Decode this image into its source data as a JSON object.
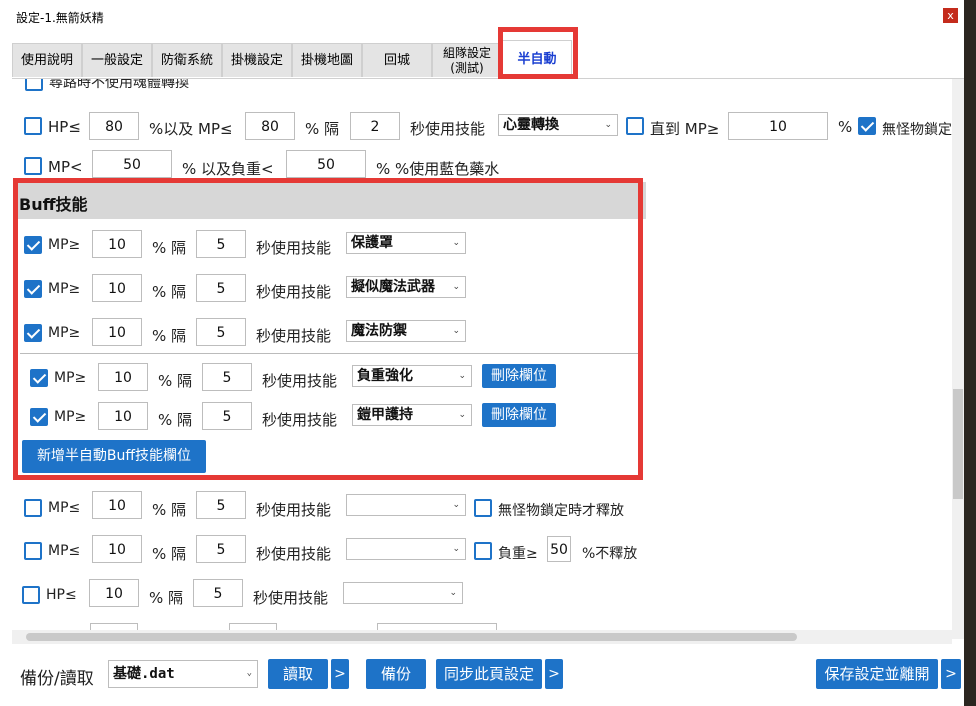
{
  "window": {
    "title": "設定-1.無箭妖精",
    "close_label": "x"
  },
  "tabs": [
    {
      "label": "使用說明"
    },
    {
      "label": "一般設定"
    },
    {
      "label": "防衛系統"
    },
    {
      "label": "掛機設定"
    },
    {
      "label": "掛機地圖"
    },
    {
      "label": "回城"
    },
    {
      "label": "組隊設定\n(測試)"
    },
    {
      "label": "半自動",
      "active": true
    }
  ],
  "top_rows": {
    "partial_label": "尋路時不使用魂體轉換",
    "hp_row": {
      "hp_label": "HP≤",
      "hp_value": "80",
      "mp_label": "%以及 MP≤",
      "mp_value": "80",
      "interval_label": "% 隔",
      "interval_value": "2",
      "skill_label": "秒使用技能",
      "skill_value": "心靈轉換",
      "until_label": "直到 MP≥",
      "until_value": "10",
      "percent": "%",
      "no_monster_label": "無怪物鎖定"
    },
    "mp_row": {
      "mp_label": "MP<",
      "mp_value": "50",
      "weight_label": "% 以及負重<",
      "weight_value": "50",
      "tail_label": "% %使用藍色藥水"
    }
  },
  "buff": {
    "title": "Buff技能",
    "fixed_rows": [
      {
        "mp_label": "MP≥",
        "mp_value": "10",
        "interval_label": "% 隔",
        "interval_value": "5",
        "skill_label": "秒使用技能",
        "skill_value": "保護罩"
      },
      {
        "mp_label": "MP≥",
        "mp_value": "10",
        "interval_label": "% 隔",
        "interval_value": "5",
        "skill_label": "秒使用技能",
        "skill_value": "擬似魔法武器"
      },
      {
        "mp_label": "MP≥",
        "mp_value": "10",
        "interval_label": "% 隔",
        "interval_value": "5",
        "skill_label": "秒使用技能",
        "skill_value": "魔法防禦"
      }
    ],
    "custom_rows": [
      {
        "mp_label": "MP≥",
        "mp_value": "10",
        "interval_label": "% 隔",
        "interval_value": "5",
        "skill_label": "秒使用技能",
        "skill_value": "負重強化",
        "delete_label": "刪除欄位"
      },
      {
        "mp_label": "MP≥",
        "mp_value": "10",
        "interval_label": "% 隔",
        "interval_value": "5",
        "skill_label": "秒使用技能",
        "skill_value": "鎧甲護持",
        "delete_label": "刪除欄位"
      }
    ],
    "add_label": "新增半自動Buff技能欄位"
  },
  "lower_rows": [
    {
      "mp_label": "MP≤",
      "mp_value": "10",
      "interval_label": "% 隔",
      "interval_value": "5",
      "skill_label": "秒使用技能",
      "skill_value": "",
      "extra_label": "無怪物鎖定時才釋放"
    },
    {
      "mp_label": "MP≤",
      "mp_value": "10",
      "interval_label": "% 隔",
      "interval_value": "5",
      "skill_label": "秒使用技能",
      "skill_value": "",
      "extra_label": "負重≥",
      "extra_value": "50",
      "extra_tail": "%不釋放"
    },
    {
      "mp_label": "HP≤",
      "mp_value": "10",
      "interval_label": "% 隔",
      "interval_value": "5",
      "skill_label": "秒使用技能",
      "skill_value": ""
    }
  ],
  "bottom": {
    "backup_label": "備份/讀取",
    "file_value": "基礎.dat",
    "read_label": "讀取",
    "more": ">",
    "backup_btn": "備份",
    "sync_label": "同步此頁設定",
    "save_label": "保存設定並離開"
  },
  "colors": {
    "accent": "#1e73c8",
    "highlight": "#e53935",
    "active_tab_text": "#1a3fd1"
  }
}
